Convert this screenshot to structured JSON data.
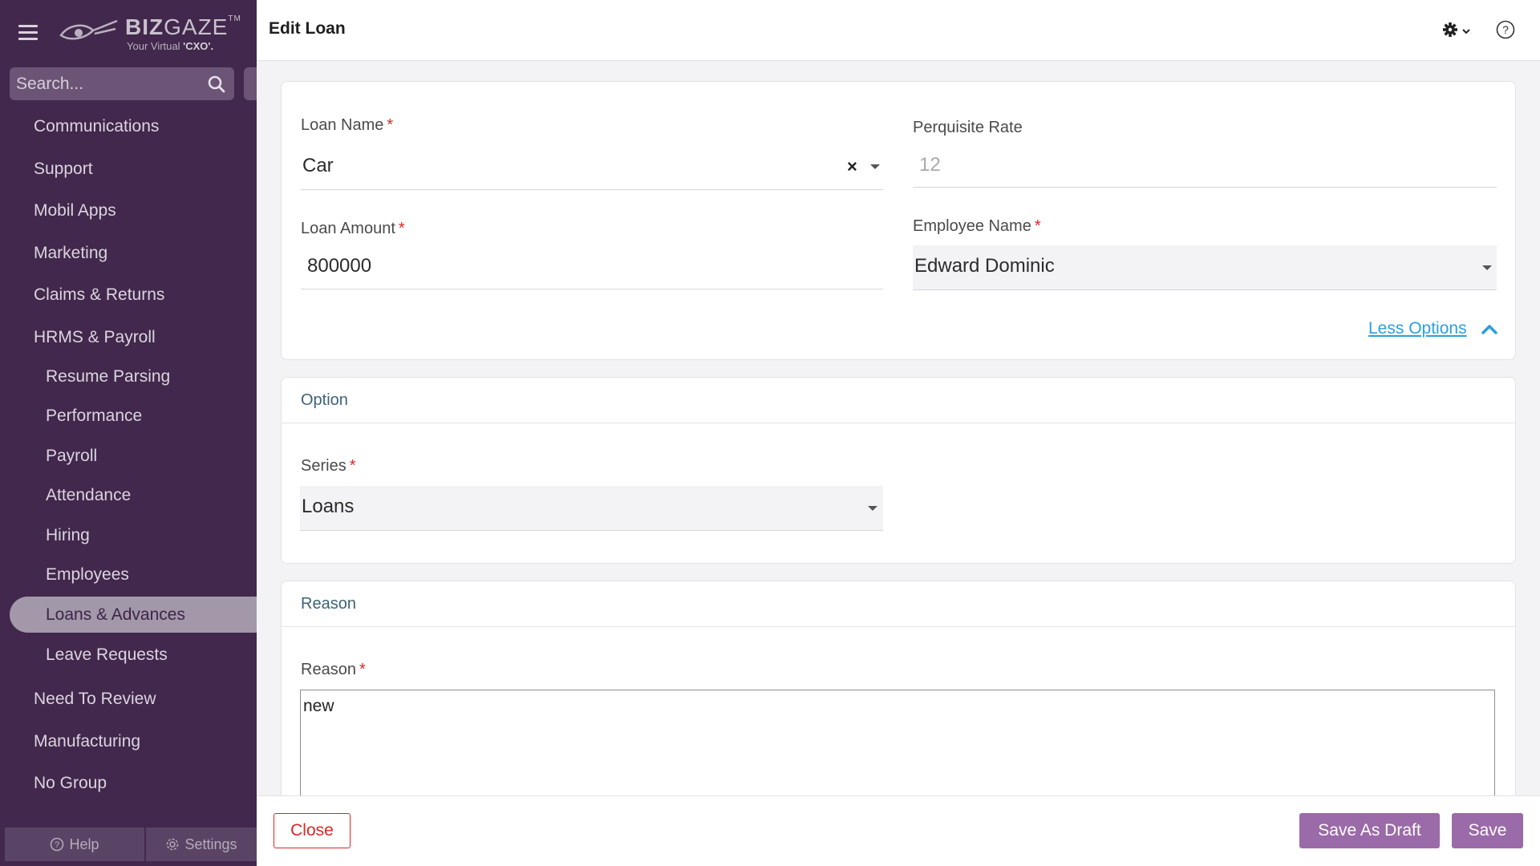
{
  "brand": {
    "name_bold": "BIZ",
    "name_light": "GAZE",
    "trademark": "TM",
    "tagline_prefix": "Your Virtual ",
    "tagline_emphasis": "'CXO'."
  },
  "sidebar": {
    "search_placeholder": "Search...",
    "items": [
      {
        "label": "Communications"
      },
      {
        "label": "Support"
      },
      {
        "label": "Mobil Apps"
      },
      {
        "label": "Marketing"
      },
      {
        "label": "Claims & Returns"
      },
      {
        "label": "HRMS & Payroll"
      },
      {
        "label": "Resume Parsing"
      },
      {
        "label": "Performance"
      },
      {
        "label": "Payroll"
      },
      {
        "label": "Attendance"
      },
      {
        "label": "Hiring"
      },
      {
        "label": "Employees"
      },
      {
        "label": "Loans & Advances"
      },
      {
        "label": "Leave Requests"
      },
      {
        "label": "Need To Review"
      },
      {
        "label": "Manufacturing"
      },
      {
        "label": "No Group"
      }
    ],
    "footer": {
      "help_label": "Help",
      "settings_label": "Settings"
    }
  },
  "header": {
    "title": "Edit Loan"
  },
  "form": {
    "loan_name": {
      "label": "Loan Name",
      "value": "Car",
      "clear": "×"
    },
    "perquisite_rate": {
      "label": "Perquisite Rate",
      "value": "12"
    },
    "loan_amount": {
      "label": "Loan Amount",
      "value": "800000"
    },
    "employee_name": {
      "label": "Employee Name",
      "value": "Edward Dominic"
    },
    "required_marker": "*",
    "less_options_label": "Less Options"
  },
  "option_section": {
    "title": "Option",
    "series": {
      "label": "Series",
      "value": "Loans"
    }
  },
  "reason_section": {
    "title": "Reason",
    "reason": {
      "label": "Reason",
      "value": "new"
    }
  },
  "actions": {
    "close_label": "Close",
    "draft_label": "Save As Draft",
    "save_label": "Save"
  },
  "colors": {
    "sidebar_bg": "#42284c",
    "active_item_bg": "#a398aa",
    "primary_button": "#9b6aa8",
    "required": "#e02424",
    "link": "#2aa0dc",
    "section_title": "#3c6377"
  },
  "icons": [
    "hamburger-icon",
    "logo-icon",
    "search-icon",
    "gear-icon",
    "chevron-down-icon",
    "help-circle-icon",
    "chevron-up-icon",
    "caret-down-icon",
    "question-icon",
    "settings-icon"
  ]
}
